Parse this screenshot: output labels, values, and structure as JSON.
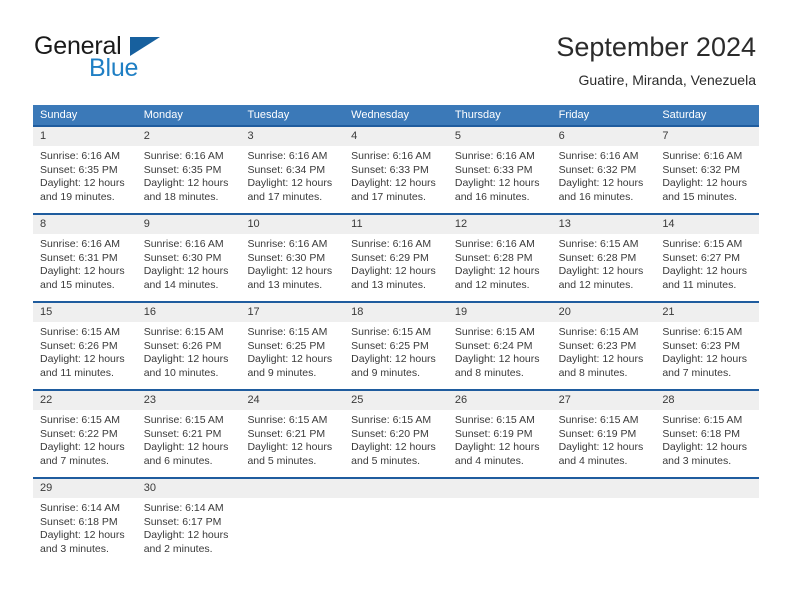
{
  "brand": {
    "name_top": "General",
    "name_bottom": "Blue",
    "triangle_icon": "brand-triangle-icon",
    "color_blue": "#1f7fc4",
    "color_triangle": "#17609e"
  },
  "header": {
    "title": "September 2024",
    "subtitle": "Guatire, Miranda, Venezuela"
  },
  "theme": {
    "header_row_bg": "#3b79b8",
    "week_border": "#1f5c9e",
    "daynum_bg": "#efefef",
    "text": "#3a3a3a"
  },
  "weekdays": [
    "Sunday",
    "Monday",
    "Tuesday",
    "Wednesday",
    "Thursday",
    "Friday",
    "Saturday"
  ],
  "weeks": [
    [
      {
        "day": "1",
        "sunrise": "Sunrise: 6:16 AM",
        "sunset": "Sunset: 6:35 PM",
        "daylight1": "Daylight: 12 hours",
        "daylight2": "and 19 minutes."
      },
      {
        "day": "2",
        "sunrise": "Sunrise: 6:16 AM",
        "sunset": "Sunset: 6:35 PM",
        "daylight1": "Daylight: 12 hours",
        "daylight2": "and 18 minutes."
      },
      {
        "day": "3",
        "sunrise": "Sunrise: 6:16 AM",
        "sunset": "Sunset: 6:34 PM",
        "daylight1": "Daylight: 12 hours",
        "daylight2": "and 17 minutes."
      },
      {
        "day": "4",
        "sunrise": "Sunrise: 6:16 AM",
        "sunset": "Sunset: 6:33 PM",
        "daylight1": "Daylight: 12 hours",
        "daylight2": "and 17 minutes."
      },
      {
        "day": "5",
        "sunrise": "Sunrise: 6:16 AM",
        "sunset": "Sunset: 6:33 PM",
        "daylight1": "Daylight: 12 hours",
        "daylight2": "and 16 minutes."
      },
      {
        "day": "6",
        "sunrise": "Sunrise: 6:16 AM",
        "sunset": "Sunset: 6:32 PM",
        "daylight1": "Daylight: 12 hours",
        "daylight2": "and 16 minutes."
      },
      {
        "day": "7",
        "sunrise": "Sunrise: 6:16 AM",
        "sunset": "Sunset: 6:32 PM",
        "daylight1": "Daylight: 12 hours",
        "daylight2": "and 15 minutes."
      }
    ],
    [
      {
        "day": "8",
        "sunrise": "Sunrise: 6:16 AM",
        "sunset": "Sunset: 6:31 PM",
        "daylight1": "Daylight: 12 hours",
        "daylight2": "and 15 minutes."
      },
      {
        "day": "9",
        "sunrise": "Sunrise: 6:16 AM",
        "sunset": "Sunset: 6:30 PM",
        "daylight1": "Daylight: 12 hours",
        "daylight2": "and 14 minutes."
      },
      {
        "day": "10",
        "sunrise": "Sunrise: 6:16 AM",
        "sunset": "Sunset: 6:30 PM",
        "daylight1": "Daylight: 12 hours",
        "daylight2": "and 13 minutes."
      },
      {
        "day": "11",
        "sunrise": "Sunrise: 6:16 AM",
        "sunset": "Sunset: 6:29 PM",
        "daylight1": "Daylight: 12 hours",
        "daylight2": "and 13 minutes."
      },
      {
        "day": "12",
        "sunrise": "Sunrise: 6:16 AM",
        "sunset": "Sunset: 6:28 PM",
        "daylight1": "Daylight: 12 hours",
        "daylight2": "and 12 minutes."
      },
      {
        "day": "13",
        "sunrise": "Sunrise: 6:15 AM",
        "sunset": "Sunset: 6:28 PM",
        "daylight1": "Daylight: 12 hours",
        "daylight2": "and 12 minutes."
      },
      {
        "day": "14",
        "sunrise": "Sunrise: 6:15 AM",
        "sunset": "Sunset: 6:27 PM",
        "daylight1": "Daylight: 12 hours",
        "daylight2": "and 11 minutes."
      }
    ],
    [
      {
        "day": "15",
        "sunrise": "Sunrise: 6:15 AM",
        "sunset": "Sunset: 6:26 PM",
        "daylight1": "Daylight: 12 hours",
        "daylight2": "and 11 minutes."
      },
      {
        "day": "16",
        "sunrise": "Sunrise: 6:15 AM",
        "sunset": "Sunset: 6:26 PM",
        "daylight1": "Daylight: 12 hours",
        "daylight2": "and 10 minutes."
      },
      {
        "day": "17",
        "sunrise": "Sunrise: 6:15 AM",
        "sunset": "Sunset: 6:25 PM",
        "daylight1": "Daylight: 12 hours",
        "daylight2": "and 9 minutes."
      },
      {
        "day": "18",
        "sunrise": "Sunrise: 6:15 AM",
        "sunset": "Sunset: 6:25 PM",
        "daylight1": "Daylight: 12 hours",
        "daylight2": "and 9 minutes."
      },
      {
        "day": "19",
        "sunrise": "Sunrise: 6:15 AM",
        "sunset": "Sunset: 6:24 PM",
        "daylight1": "Daylight: 12 hours",
        "daylight2": "and 8 minutes."
      },
      {
        "day": "20",
        "sunrise": "Sunrise: 6:15 AM",
        "sunset": "Sunset: 6:23 PM",
        "daylight1": "Daylight: 12 hours",
        "daylight2": "and 8 minutes."
      },
      {
        "day": "21",
        "sunrise": "Sunrise: 6:15 AM",
        "sunset": "Sunset: 6:23 PM",
        "daylight1": "Daylight: 12 hours",
        "daylight2": "and 7 minutes."
      }
    ],
    [
      {
        "day": "22",
        "sunrise": "Sunrise: 6:15 AM",
        "sunset": "Sunset: 6:22 PM",
        "daylight1": "Daylight: 12 hours",
        "daylight2": "and 7 minutes."
      },
      {
        "day": "23",
        "sunrise": "Sunrise: 6:15 AM",
        "sunset": "Sunset: 6:21 PM",
        "daylight1": "Daylight: 12 hours",
        "daylight2": "and 6 minutes."
      },
      {
        "day": "24",
        "sunrise": "Sunrise: 6:15 AM",
        "sunset": "Sunset: 6:21 PM",
        "daylight1": "Daylight: 12 hours",
        "daylight2": "and 5 minutes."
      },
      {
        "day": "25",
        "sunrise": "Sunrise: 6:15 AM",
        "sunset": "Sunset: 6:20 PM",
        "daylight1": "Daylight: 12 hours",
        "daylight2": "and 5 minutes."
      },
      {
        "day": "26",
        "sunrise": "Sunrise: 6:15 AM",
        "sunset": "Sunset: 6:19 PM",
        "daylight1": "Daylight: 12 hours",
        "daylight2": "and 4 minutes."
      },
      {
        "day": "27",
        "sunrise": "Sunrise: 6:15 AM",
        "sunset": "Sunset: 6:19 PM",
        "daylight1": "Daylight: 12 hours",
        "daylight2": "and 4 minutes."
      },
      {
        "day": "28",
        "sunrise": "Sunrise: 6:15 AM",
        "sunset": "Sunset: 6:18 PM",
        "daylight1": "Daylight: 12 hours",
        "daylight2": "and 3 minutes."
      }
    ],
    [
      {
        "day": "29",
        "sunrise": "Sunrise: 6:14 AM",
        "sunset": "Sunset: 6:18 PM",
        "daylight1": "Daylight: 12 hours",
        "daylight2": "and 3 minutes."
      },
      {
        "day": "30",
        "sunrise": "Sunrise: 6:14 AM",
        "sunset": "Sunset: 6:17 PM",
        "daylight1": "Daylight: 12 hours",
        "daylight2": "and 2 minutes."
      },
      {
        "day": "",
        "sunrise": "",
        "sunset": "",
        "daylight1": "",
        "daylight2": ""
      },
      {
        "day": "",
        "sunrise": "",
        "sunset": "",
        "daylight1": "",
        "daylight2": ""
      },
      {
        "day": "",
        "sunrise": "",
        "sunset": "",
        "daylight1": "",
        "daylight2": ""
      },
      {
        "day": "",
        "sunrise": "",
        "sunset": "",
        "daylight1": "",
        "daylight2": ""
      },
      {
        "day": "",
        "sunrise": "",
        "sunset": "",
        "daylight1": "",
        "daylight2": ""
      }
    ]
  ]
}
